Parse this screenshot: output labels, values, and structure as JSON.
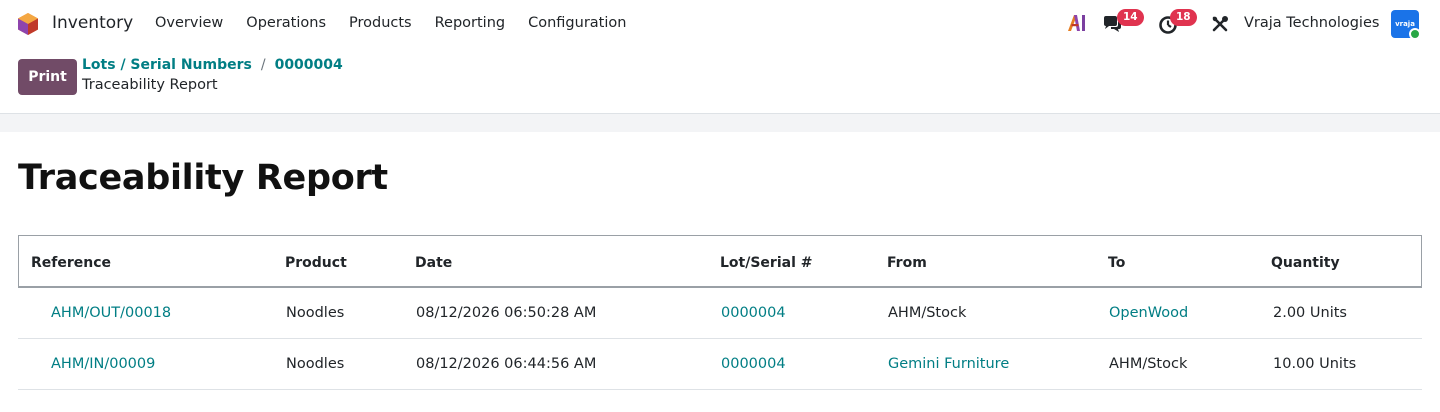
{
  "nav": {
    "app_name": "Inventory",
    "menu": [
      "Overview",
      "Operations",
      "Products",
      "Reporting",
      "Configuration"
    ],
    "chat_count": "14",
    "activity_count": "18",
    "company": "Vraja Technologies",
    "avatar_text": "vraja"
  },
  "control": {
    "print_label": "Print",
    "breadcrumb_parent": "Lots / Serial Numbers",
    "breadcrumb_separator": "/",
    "breadcrumb_current": "0000004",
    "view_title": "Traceability Report"
  },
  "report": {
    "title": "Traceability Report",
    "columns": [
      "Reference",
      "Product",
      "Date",
      "Lot/Serial #",
      "From",
      "To",
      "Quantity"
    ],
    "rows": [
      {
        "reference": "AHM/OUT/00018",
        "product": "Noodles",
        "date": "08/12/2026 06:50:28 AM",
        "lot": "0000004",
        "from": "AHM/Stock",
        "to": "OpenWood",
        "quantity": "2.00 Units"
      },
      {
        "reference": "AHM/IN/00009",
        "product": "Noodles",
        "date": "08/12/2026 06:44:56 AM",
        "lot": "0000004",
        "from": "Gemini Furniture",
        "to": "AHM/Stock",
        "quantity": "10.00 Units"
      }
    ]
  },
  "colors": {
    "brand": "#714b67",
    "link": "#017e84",
    "badge": "#e0334f"
  }
}
